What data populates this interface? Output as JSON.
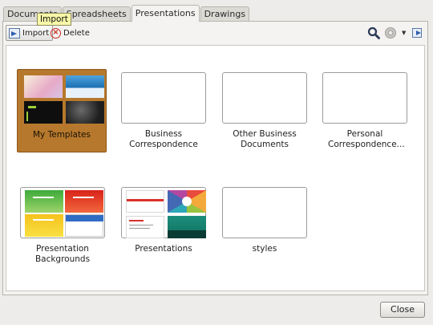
{
  "tabs": [
    "Documents",
    "Spreadsheets",
    "Presentations",
    "Drawings"
  ],
  "active_tab": "Presentations",
  "toolbar": {
    "import_label": "Import",
    "delete_label": "Delete",
    "tooltip": "Import"
  },
  "folders": [
    {
      "label": "My Templates",
      "selected": true
    },
    {
      "label": "Business Correspondence",
      "selected": false
    },
    {
      "label": "Other Business Documents",
      "selected": false
    },
    {
      "label": "Personal Correspondence...",
      "selected": false
    },
    {
      "label": "Presentation Backgrounds",
      "selected": false
    },
    {
      "label": "Presentations",
      "selected": false
    },
    {
      "label": "styles",
      "selected": false
    }
  ],
  "close_label": "Close",
  "colors": {
    "selection": "#b6782d",
    "tooltip_bg": "#f8f7a8",
    "delete_red": "#c8261e",
    "icon_blue": "#2f5fb0"
  }
}
